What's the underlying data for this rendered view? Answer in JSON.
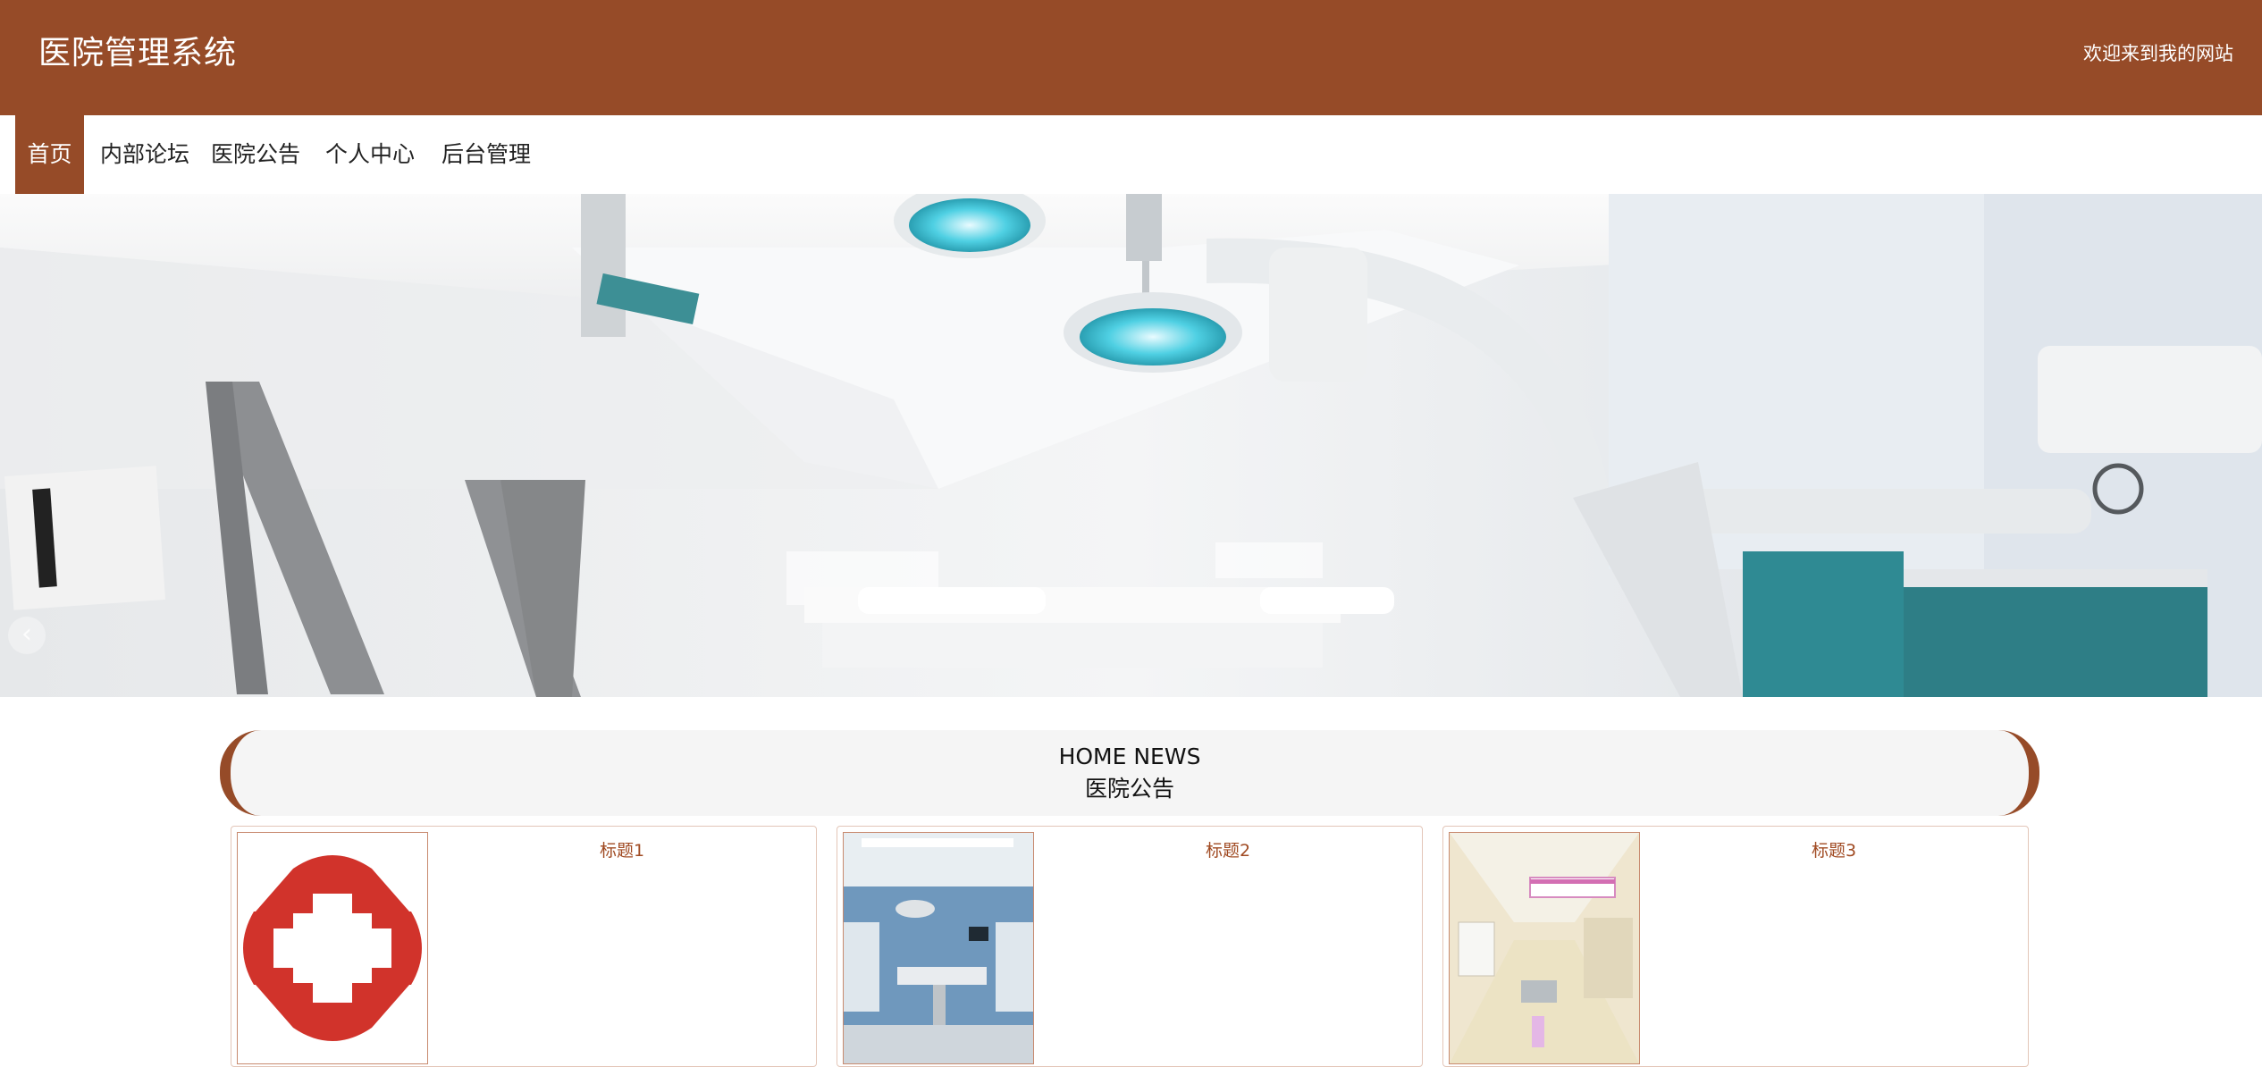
{
  "header": {
    "title": "医院管理系统",
    "welcome": "欢迎来到我的网站",
    "background_color": "#964b28"
  },
  "nav": {
    "items": [
      {
        "label": "首页",
        "active": true
      },
      {
        "label": "内部论坛",
        "active": false
      },
      {
        "label": "医院公告",
        "active": false
      },
      {
        "label": "个人中心",
        "active": false
      },
      {
        "label": "后台管理",
        "active": false
      }
    ]
  },
  "banner": {
    "prev_icon": "chevron-left-icon",
    "slide_count": 3,
    "active_slide": 3
  },
  "news": {
    "title_en": "HOME NEWS",
    "title_cn": "医院公告",
    "items": [
      {
        "title": "标题1"
      },
      {
        "title": "标题2"
      },
      {
        "title": "标题3"
      }
    ]
  },
  "colors": {
    "accent": "#964b28",
    "link": "#a04a22"
  }
}
